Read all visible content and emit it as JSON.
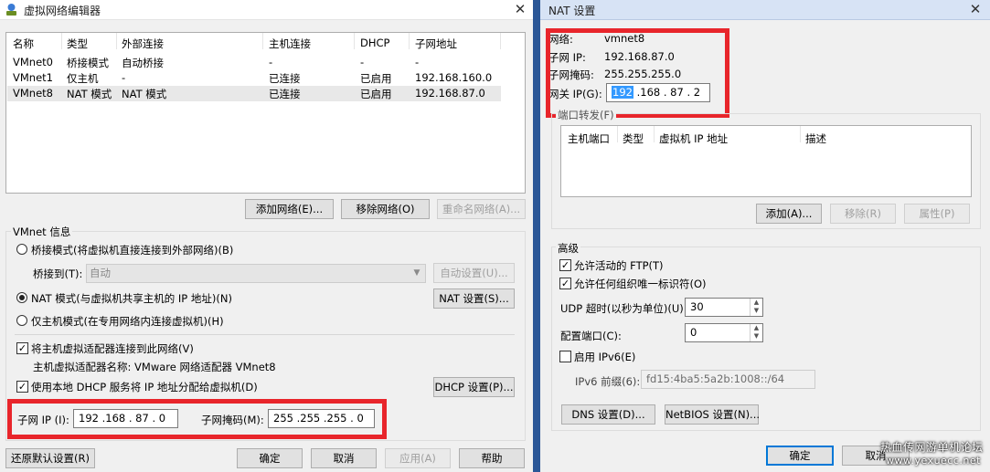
{
  "left": {
    "title": "虚拟网络编辑器",
    "columns": [
      "名称",
      "类型",
      "外部连接",
      "主机连接",
      "DHCP",
      "子网地址"
    ],
    "rows": [
      [
        "VMnet0",
        "桥接模式",
        "自动桥接",
        "-",
        "-",
        "-"
      ],
      [
        "VMnet1",
        "仅主机",
        "-",
        "已连接",
        "已启用",
        "192.168.160.0"
      ],
      [
        "VMnet8",
        "NAT 模式",
        "NAT 模式",
        "已连接",
        "已启用",
        "192.168.87.0"
      ]
    ],
    "buttons": {
      "add": "添加网络(E)...",
      "remove": "移除网络(O)",
      "rename": "重命名网络(A)..."
    },
    "vmnet_info_label": "VMnet 信息",
    "bridge_mode": "桥接模式(将虚拟机直接连接到外部网络)(B)",
    "bridge_to_label": "桥接到(T):",
    "bridge_to_value": "自动",
    "auto_settings": "自动设置(U)...",
    "nat_mode": "NAT 模式(与虚拟机共享主机的 IP 地址)(N)",
    "nat_settings": "NAT 设置(S)...",
    "host_only": "仅主机模式(在专用网络内连接虚拟机)(H)",
    "connect_adapter": "将主机虚拟适配器连接到此网络(V)",
    "adapter_name": "主机虚拟适配器名称: VMware 网络适配器 VMnet8",
    "use_dhcp": "使用本地 DHCP 服务将 IP 地址分配给虚拟机(D)",
    "dhcp_settings": "DHCP 设置(P)...",
    "subnet_ip_label": "子网 IP (I):",
    "subnet_ip": "192 .168 . 87  .  0",
    "subnet_mask_label": "子网掩码(M):",
    "subnet_mask": "255 .255 .255 .  0",
    "restore": "还原默认设置(R)",
    "ok": "确定",
    "cancel": "取消",
    "apply": "应用(A)",
    "help": "帮助"
  },
  "right": {
    "title": "NAT 设置",
    "network_label": "网络:",
    "network_value": "vmnet8",
    "subnet_ip_label": "子网 IP:",
    "subnet_ip_value": "192.168.87.0",
    "subnet_mask_label": "子网掩码:",
    "subnet_mask_value": "255.255.255.0",
    "gateway_label": "网关 IP(G):",
    "gateway_selected": "192",
    "gateway_rest": " .168 . 87  .  2",
    "port_forward_label": "端口转发(F)",
    "port_columns": [
      "主机端口",
      "类型",
      "虚拟机 IP 地址",
      "描述"
    ],
    "add": "添加(A)...",
    "remove": "移除(R)",
    "properties": "属性(P)",
    "advanced_label": "高级",
    "allow_ftp": "允许活动的 FTP(T)",
    "allow_oui": "允许任何组织唯一标识符(O)",
    "udp_label": "UDP 超时(以秒为单位)(U):",
    "udp_value": "30",
    "config_port_label": "配置端口(C):",
    "config_port_value": "0",
    "enable_ipv6": "启用 IPv6(E)",
    "ipv6_prefix_label": "IPv6 前缀(6):",
    "ipv6_prefix_value": "fd15:4ba5:5a2b:1008::/64",
    "dns": "DNS 设置(D)...",
    "netbios": "NetBIOS 设置(N)...",
    "ok": "确定",
    "cancel": "取消",
    "watermark1": "热血传网游单机论坛",
    "watermark2": "www.yexuecc.net"
  }
}
